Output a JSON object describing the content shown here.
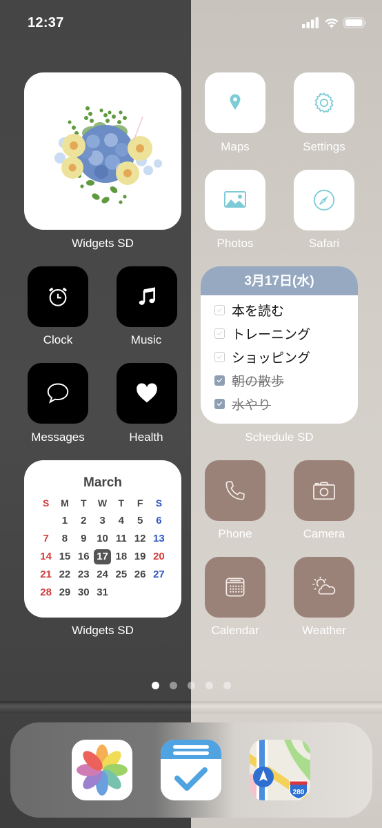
{
  "status_bar": {
    "time": "12:37",
    "icons": [
      "cellular-signal-icon",
      "wifi-icon",
      "battery-icon"
    ]
  },
  "widgets": {
    "flower_widget": {
      "label": "Widgets SD",
      "image": "flower-bouquet-illustration"
    },
    "schedule_widget": {
      "date": "3月17日(水)",
      "label": "Schedule SD",
      "tasks": [
        {
          "text": "本を読む",
          "done": false
        },
        {
          "text": "トレーニング",
          "done": false
        },
        {
          "text": "ショッピング",
          "done": false
        },
        {
          "text": "朝の散歩",
          "done": true
        },
        {
          "text": "水やり",
          "done": true
        }
      ],
      "header_color": "#96a9c0"
    },
    "calendar_widget": {
      "month": "March",
      "label": "Widgets SD",
      "weekdays": [
        "S",
        "M",
        "T",
        "W",
        "T",
        "F",
        "S"
      ],
      "weeks": [
        [
          "",
          "1",
          "2",
          "3",
          "4",
          "5",
          "6"
        ],
        [
          "7",
          "8",
          "9",
          "10",
          "11",
          "12",
          "13"
        ],
        [
          "14",
          "15",
          "16",
          "17",
          "18",
          "19",
          "20"
        ],
        [
          "21",
          "22",
          "23",
          "24",
          "25",
          "26",
          "27"
        ],
        [
          "28",
          "29",
          "30",
          "31",
          "",
          "",
          ""
        ]
      ],
      "today": "17",
      "red_days": [
        "7",
        "14",
        "20",
        "21",
        "28"
      ],
      "blue_days": [
        "6",
        "13",
        "27"
      ]
    }
  },
  "apps": {
    "maps": {
      "label": "Maps",
      "icon": "map-pin-icon"
    },
    "settings": {
      "label": "Settings",
      "icon": "gear-icon"
    },
    "photos": {
      "label": "Photos",
      "icon": "image-icon"
    },
    "safari": {
      "label": "Safari",
      "icon": "compass-icon"
    },
    "clock": {
      "label": "Clock",
      "icon": "alarm-clock-icon"
    },
    "music": {
      "label": "Music",
      "icon": "music-note-icon"
    },
    "messages": {
      "label": "Messages",
      "icon": "speech-bubble-icon"
    },
    "health": {
      "label": "Health",
      "icon": "heart-icon"
    },
    "phone": {
      "label": "Phone",
      "icon": "phone-icon"
    },
    "camera": {
      "label": "Camera",
      "icon": "camera-icon"
    },
    "calendar": {
      "label": "Calendar",
      "icon": "calendar-icon"
    },
    "weather": {
      "label": "Weather",
      "icon": "sun-cloud-icon"
    }
  },
  "page_indicator": {
    "pages": 5,
    "current": 1
  },
  "dock": {
    "apps": [
      {
        "name": "Photos",
        "icon": "photos-flower-icon"
      },
      {
        "name": "Tasks",
        "icon": "checklist-icon"
      },
      {
        "name": "Maps",
        "icon": "apple-maps-icon",
        "route_shield": "280"
      }
    ]
  },
  "colors": {
    "accent_blue": "#7ecbd8",
    "brown_icon_bg": "#9b8279",
    "sunday_red": "#d33b3b",
    "saturday_blue": "#2e56c5"
  }
}
